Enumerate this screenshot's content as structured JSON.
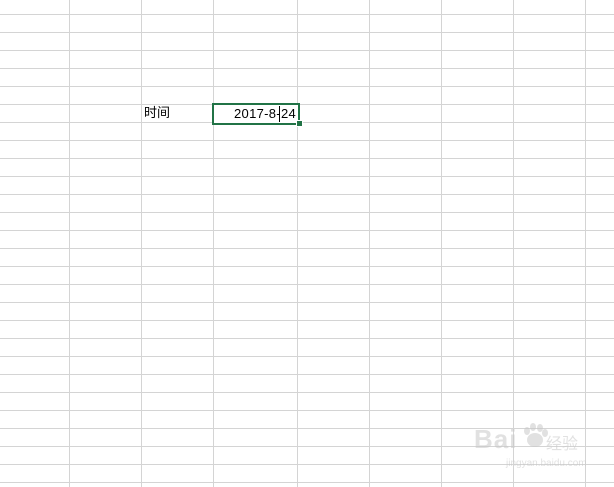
{
  "sheet": {
    "label_cell": "时间",
    "active_cell_value": "2017-8-24"
  },
  "colors": {
    "gridline": "#d4d4d4",
    "selection": "#217346",
    "background": "#ffffff"
  },
  "watermark": {
    "brand": "Bai",
    "sub": "经验",
    "url": "jingyan.baidu.com",
    "icon": "baidu-paw-icon"
  }
}
